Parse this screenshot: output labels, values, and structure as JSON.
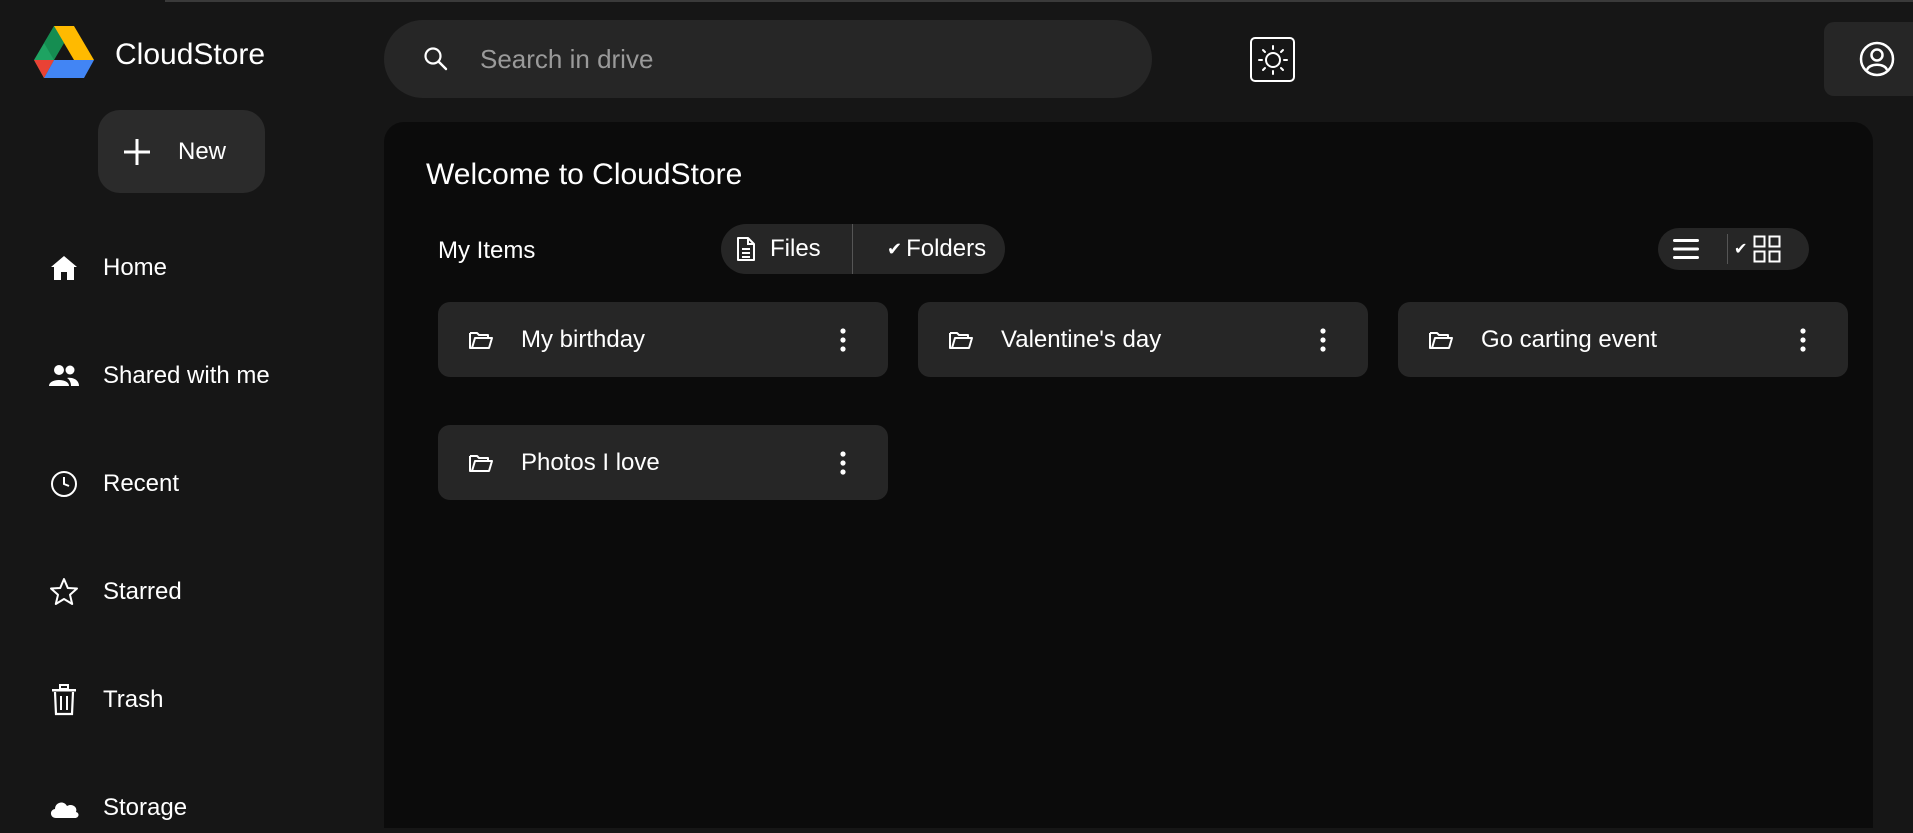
{
  "app": {
    "brand_name": "CloudStore",
    "accent_colors": {
      "green": "#1ea362",
      "yellow": "#ffba00",
      "blue": "#4285f4",
      "red": "#e94235"
    }
  },
  "sidebar": {
    "new_button_label": "New",
    "items": [
      {
        "label": "Home",
        "icon": "home-icon"
      },
      {
        "label": "Shared with me",
        "icon": "people-icon"
      },
      {
        "label": "Recent",
        "icon": "clock-icon"
      },
      {
        "label": "Starred",
        "icon": "star-icon"
      },
      {
        "label": "Trash",
        "icon": "trash-icon"
      },
      {
        "label": "Storage",
        "icon": "cloud-icon"
      }
    ]
  },
  "header": {
    "search_placeholder": "Search in drive",
    "theme_toggle_icon": "sun-icon",
    "account_icon": "account-icon"
  },
  "main": {
    "welcome_title": "Welcome to CloudStore",
    "section_label": "My Items",
    "filter": {
      "files_label": "Files",
      "folders_label": "Folders",
      "selected": "Folders"
    },
    "view_mode": {
      "selected": "grid"
    },
    "folders": [
      {
        "name": "My birthday"
      },
      {
        "name": "Valentine's day"
      },
      {
        "name": "Go carting event"
      },
      {
        "name": "Photos I love"
      }
    ]
  }
}
